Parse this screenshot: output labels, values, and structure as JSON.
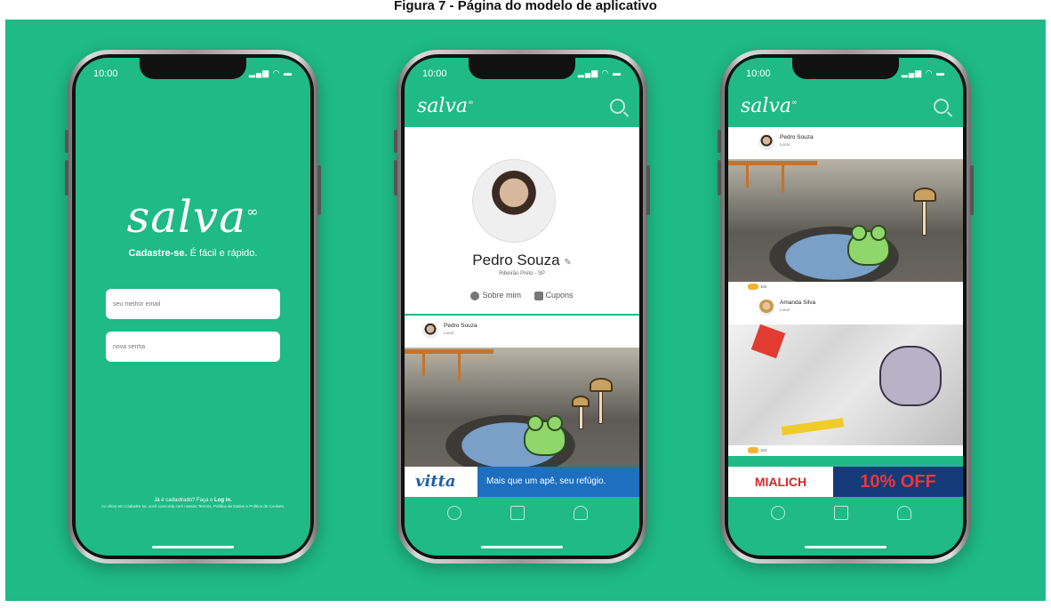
{
  "caption": "Figura 7 - Página do modelo de aplicativo",
  "status": {
    "time": "10:00"
  },
  "brand": {
    "name": "salva"
  },
  "login": {
    "tagline_bold": "Cadastre-se.",
    "tagline_rest": " É fácil e rápido.",
    "email_placeholder": "seu melhor email",
    "password_placeholder": "nova senha",
    "footer_prefix": "Já é cadastrado? Faça o ",
    "footer_link": "Log in.",
    "legal": "Ao clicar em Cadastre-se, você concorda com nossos Termos, Política de Dados e Política de Cookies."
  },
  "profile": {
    "name": "Pedro Souza",
    "location": "Ribeirão Preto - SP",
    "tab_about": "Sobre mim",
    "tab_coupons": "Cupons"
  },
  "posts": [
    {
      "author": "Pedro Souza",
      "place": "Local",
      "reactions": "104"
    },
    {
      "author": "Amanda Silva",
      "place": "Local",
      "reactions": "104"
    }
  ],
  "ads": {
    "vitta_brand": "vitta",
    "vitta_slogan": "Mais que um apê, seu refúgio.",
    "mialich_brand": "MIALICH",
    "mialich_offer": "10% OFF"
  },
  "colors": {
    "brand_green": "#1FBA86",
    "ad_blue": "#1e6fc0",
    "offer_red": "#e8383b"
  }
}
